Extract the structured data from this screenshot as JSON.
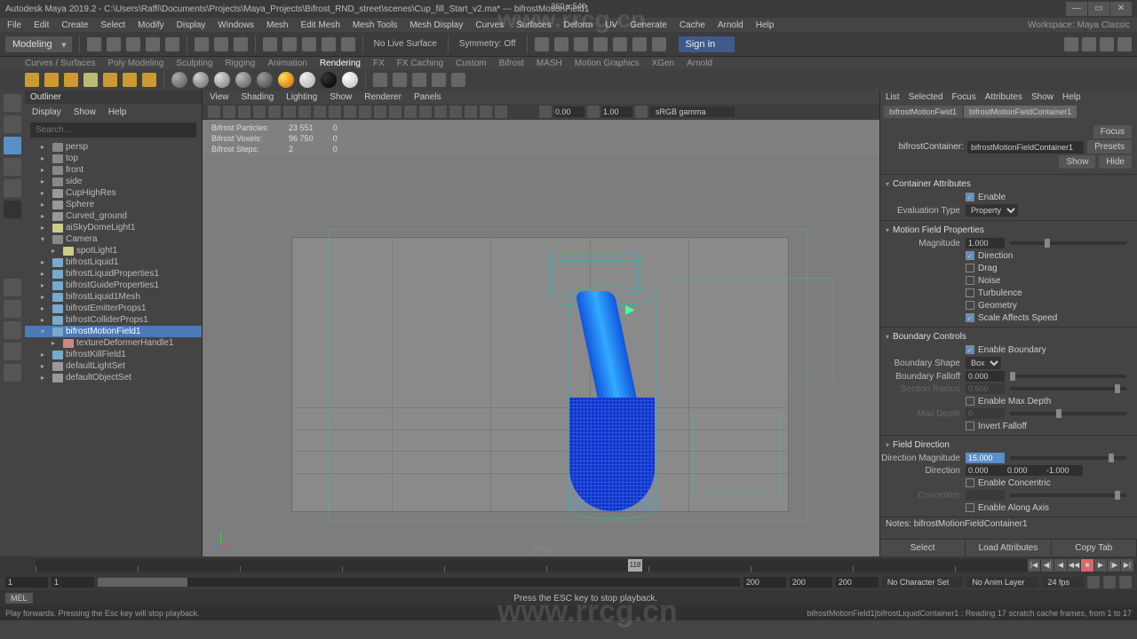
{
  "title": "Autodesk Maya 2019.2 - C:\\Users\\Raffi\\Documents\\Projects\\Maya_Projects\\Bifrost_RND_street\\scenes\\Cup_fill_Start_v2.ma* --- bifrostMotionField1",
  "mainmenu": [
    "File",
    "Edit",
    "Create",
    "Select",
    "Modify",
    "Display",
    "Windows",
    "Mesh",
    "Edit Mesh",
    "Mesh Tools",
    "Mesh Display",
    "Curves",
    "Surfaces",
    "Deform",
    "UV",
    "Generate",
    "Cache",
    "Arnold",
    "Help"
  ],
  "workspace": {
    "label": "Workspace:",
    "value": "Maya Classic"
  },
  "shelf": {
    "mode": "Modeling",
    "liveSurface": "No Live Surface",
    "symmetry": "Symmetry: Off",
    "signin": "Sign in"
  },
  "shelftabs": [
    "Curves / Surfaces",
    "Poly Modeling",
    "Sculpting",
    "Rigging",
    "Animation",
    "Rendering",
    "FX",
    "FX Caching",
    "Custom",
    "Bifrost",
    "MASH",
    "Motion Graphics",
    "XGen",
    "Arnold"
  ],
  "shelfActive": "Rendering",
  "outliner": {
    "title": "Outliner",
    "menu": [
      "Display",
      "Show",
      "Help"
    ],
    "searchPH": "Search...",
    "items": [
      {
        "n": "persp",
        "ic": "cam",
        "i": 1
      },
      {
        "n": "top",
        "ic": "cam",
        "i": 1
      },
      {
        "n": "front",
        "ic": "cam",
        "i": 1
      },
      {
        "n": "side",
        "ic": "cam",
        "i": 1
      },
      {
        "n": "CupHighRes",
        "ic": "g",
        "i": 1
      },
      {
        "n": "Sphere",
        "ic": "g",
        "i": 1
      },
      {
        "n": "Curved_ground",
        "ic": "g",
        "i": 1
      },
      {
        "n": "aiSkyDomeLight1",
        "ic": "l",
        "i": 1
      },
      {
        "n": "Camera",
        "ic": "cam",
        "i": 1,
        "exp": true
      },
      {
        "n": "spotLight1",
        "ic": "l",
        "i": 2
      },
      {
        "n": "bifrostLiquid1",
        "ic": "b",
        "i": 1
      },
      {
        "n": "bifrostLiquidProperties1",
        "ic": "b",
        "i": 1
      },
      {
        "n": "bifrostGuideProperties1",
        "ic": "b",
        "i": 1
      },
      {
        "n": "bifrostLiquid1Mesh",
        "ic": "b",
        "i": 1
      },
      {
        "n": "bifrostEmitterProps1",
        "ic": "b",
        "i": 1
      },
      {
        "n": "bifrostColliderProps1",
        "ic": "b",
        "i": 1
      },
      {
        "n": "bifrostMotionField1",
        "ic": "b",
        "i": 1,
        "sel": true,
        "exp": true
      },
      {
        "n": "textureDeformerHandle1",
        "ic": "s",
        "i": 2
      },
      {
        "n": "bifrostKillField1",
        "ic": "b",
        "i": 1
      },
      {
        "n": "defaultLightSet",
        "ic": "g",
        "i": 1
      },
      {
        "n": "defaultObjectSet",
        "ic": "g",
        "i": 1
      }
    ]
  },
  "viewport": {
    "menu": [
      "View",
      "Shading",
      "Lighting",
      "Show",
      "Renderer",
      "Panels"
    ],
    "near": "0.00",
    "far": "1.00",
    "gamma": "sRGB gamma",
    "dim": "360 x 540",
    "camera": "persp",
    "stats": {
      "rows": [
        {
          "l": "Bifrost Particles:",
          "a": "23 551",
          "b": "0"
        },
        {
          "l": "Bifrost Voxels:",
          "a": "96 750",
          "b": "0"
        },
        {
          "l": "Bifrost Steps:",
          "a": "2",
          "b": "0"
        }
      ]
    }
  },
  "attr": {
    "menu": [
      "List",
      "Selected",
      "Focus",
      "Attributes",
      "Show",
      "Help"
    ],
    "tabs": [
      "bifrostMotionField1",
      "bifrostMotionFieldContainer1"
    ],
    "focus": "Focus",
    "presets": "Presets",
    "show": "Show",
    "hide": "Hide",
    "containerLabel": "bifrostContainer:",
    "containerVal": "bifrostMotionFieldContainer1",
    "sections": {
      "containerAttrs": {
        "title": "Container Attributes",
        "enable": "Enable",
        "evalType": "Evaluation Type",
        "evalVal": "Property"
      },
      "motionField": {
        "title": "Motion Field Properties",
        "magnitude": "Magnitude",
        "magVal": "1.000",
        "flags": [
          "Direction",
          "Drag",
          "Noise",
          "Turbulence",
          "Geometry",
          "Scale Affects Speed"
        ],
        "flagsOn": [
          true,
          false,
          false,
          false,
          false,
          true
        ]
      },
      "boundary": {
        "title": "Boundary Controls",
        "enable": "Enable Boundary",
        "shape": "Boundary Shape",
        "shapeVal": "Box",
        "falloff": "Boundary Falloff",
        "falloffVal": "0.000",
        "secRadius": "Section Radius",
        "secRadiusVal": "0.500",
        "maxDepth": "Enable Max Depth",
        "maxDepthL": "Max Depth",
        "maxDepthVal": "0",
        "invert": "Invert Falloff"
      },
      "fieldDir": {
        "title": "Field Direction",
        "dirMag": "Direction Magnitude",
        "dirMagVal": "15.000",
        "dir": "Direction",
        "dirX": "0.000",
        "dirY": "0.000",
        "dirZ": "-1.000",
        "concentric": "Enable Concentric",
        "concL": "Concentric",
        "concVal": "",
        "alongAxis": "Enable Along Axis"
      }
    },
    "notesLabel": "Notes: ",
    "notesVal": "bifrostMotionFieldContainer1",
    "bottom": [
      "Select",
      "Load Attributes",
      "Copy Tab"
    ]
  },
  "timeline": {
    "current": "118"
  },
  "range": {
    "s1": "1",
    "s2": "1",
    "e1": "200",
    "e2": "200",
    "e3": "200",
    "charset": "No Character Set",
    "animlayer": "No Anim Layer",
    "fps": "24 fps"
  },
  "cmd": {
    "tag": "MEL",
    "msg": "Press the ESC key to stop playback."
  },
  "status": {
    "left": "Play forwards. Pressing the Esc key will stop playback.",
    "right": "bifrostMotionField1|bifrostLiquidContainer1 : Reading 17 scratch cache frames, from 1 to 17"
  },
  "watermark": "www.rrcg.cn"
}
